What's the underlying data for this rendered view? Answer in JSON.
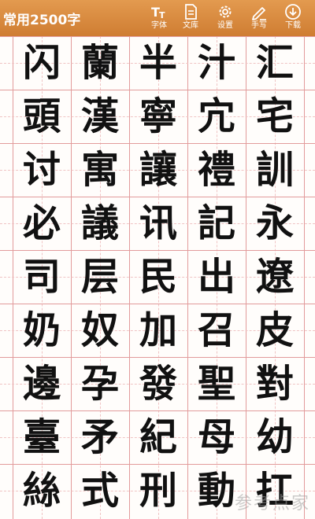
{
  "toolbar": {
    "title": "常用2500字",
    "buttons": [
      {
        "label": "字体",
        "icon": "font-icon"
      },
      {
        "label": "文库",
        "icon": "document-icon"
      },
      {
        "label": "设置",
        "icon": "gear-icon"
      },
      {
        "label": "手写",
        "icon": "pencil-icon"
      },
      {
        "label": "下载",
        "icon": "download-icon"
      }
    ]
  },
  "colors": {
    "toolbar": "#d8873c",
    "grid_line": "#e29b9b"
  },
  "grid": {
    "rows": [
      [
        "闪",
        "蘭",
        "半",
        "汁",
        "汇"
      ],
      [
        "頭",
        "漢",
        "寧",
        "宂",
        "宅"
      ],
      [
        "讨",
        "寓",
        "讓",
        "禮",
        "訓"
      ],
      [
        "必",
        "議",
        "讯",
        "記",
        "永"
      ],
      [
        "司",
        "层",
        "民",
        "出",
        "遼"
      ],
      [
        "奶",
        "奴",
        "加",
        "召",
        "皮"
      ],
      [
        "邊",
        "孕",
        "發",
        "聖",
        "對"
      ],
      [
        "臺",
        "矛",
        "紀",
        "母",
        "幼"
      ],
      [
        "絲",
        "式",
        "刑",
        "動",
        "扛"
      ]
    ]
  },
  "watermark": "参考点家"
}
